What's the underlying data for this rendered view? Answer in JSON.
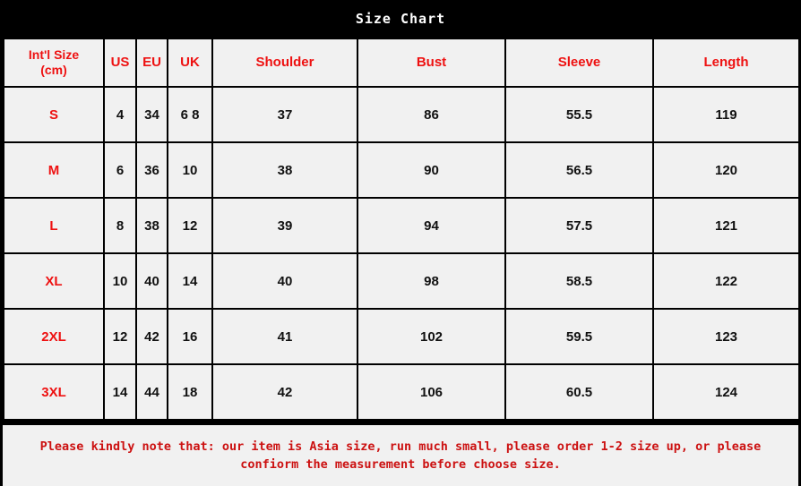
{
  "title": "Size Chart",
  "table": {
    "headers": [
      "Int'l Size",
      "(cm)",
      "US",
      "EU",
      "UK",
      "Shoulder",
      "Bust",
      "Sleeve",
      "Length"
    ],
    "rows": [
      {
        "size": "S",
        "us": "4",
        "eu": "34",
        "uk": "6 8",
        "shoulder": "37",
        "bust": "86",
        "sleeve": "55.5",
        "length": "119"
      },
      {
        "size": "M",
        "us": "6",
        "eu": "36",
        "uk": "10",
        "shoulder": "38",
        "bust": "90",
        "sleeve": "56.5",
        "length": "120"
      },
      {
        "size": "L",
        "us": "8",
        "eu": "38",
        "uk": "12",
        "shoulder": "39",
        "bust": "94",
        "sleeve": "57.5",
        "length": "121"
      },
      {
        "size": "XL",
        "us": "10",
        "eu": "40",
        "uk": "14",
        "shoulder": "40",
        "bust": "98",
        "sleeve": "58.5",
        "length": "122"
      },
      {
        "size": "2XL",
        "us": "12",
        "eu": "42",
        "uk": "16",
        "shoulder": "41",
        "bust": "102",
        "sleeve": "59.5",
        "length": "123"
      },
      {
        "size": "3XL",
        "us": "14",
        "eu": "44",
        "uk": "18",
        "shoulder": "42",
        "bust": "106",
        "sleeve": "60.5",
        "length": "124"
      }
    ]
  },
  "footer": {
    "note": "Please  kindly note that: our item is Asia size, run much small, please order 1-2 size up, or please confiorm the measurement before choose size."
  },
  "colors": {
    "background": "#000000",
    "cell_background": "#f1f1f1",
    "header_text": "#ee1111",
    "data_text": "#111111",
    "title_text": "#ffffff",
    "footer_text": "#cc1111",
    "border": "#000000"
  }
}
